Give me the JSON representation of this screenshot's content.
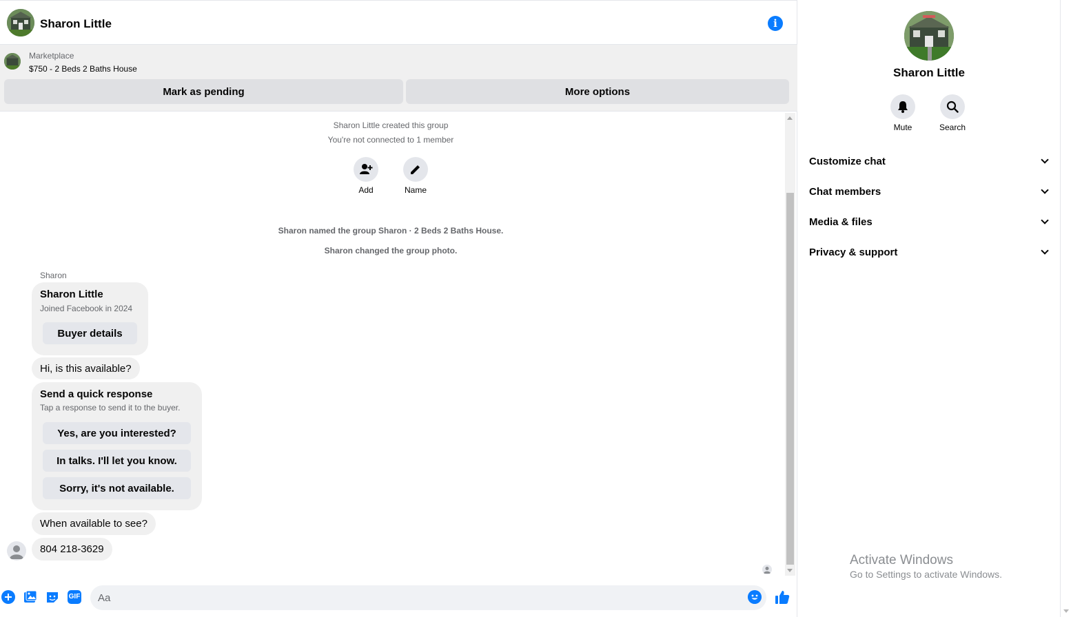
{
  "header": {
    "contact_name": "Sharon Little",
    "info_icon": "info-icon"
  },
  "marketplace": {
    "label": "Marketplace",
    "listing": "$750 - 2 Beds 2 Baths House",
    "mark_pending": "Mark as pending",
    "more_options": "More options"
  },
  "timeline": {
    "created": "Sharon Little created this group",
    "not_connected": "You're not connected to 1 member",
    "actions": [
      {
        "label": "Add",
        "icon": "add-person-icon"
      },
      {
        "label": "Name",
        "icon": "pencil-icon"
      }
    ],
    "named_group": "Sharon named the group Sharon · 2 Beds 2 Baths House.",
    "changed_photo": "Sharon changed the group photo."
  },
  "messages": {
    "sender": "Sharon",
    "profile_card": {
      "name": "Sharon Little",
      "joined": "Joined Facebook in 2024",
      "button": "Buyer details"
    },
    "msg1": "Hi, is this available?",
    "quick_response": {
      "title": "Send a quick response",
      "subtitle": "Tap a response to send it to the buyer.",
      "options": [
        "Yes, are you interested?",
        "In talks. I'll let you know.",
        "Sorry, it's not available."
      ]
    },
    "msg2": "When available to see?",
    "msg3": "804 218-3629"
  },
  "composer": {
    "placeholder": "Aa",
    "icons": [
      "plus-icon",
      "image-icon",
      "sticker-icon",
      "gif-icon",
      "emoji-icon",
      "like-icon"
    ],
    "gif_label": "GIF"
  },
  "panel": {
    "name": "Sharon Little",
    "actions": [
      {
        "label": "Mute",
        "icon": "bell-icon"
      },
      {
        "label": "Search",
        "icon": "search-icon"
      }
    ],
    "sections": [
      "Customize chat",
      "Chat members",
      "Media & files",
      "Privacy & support"
    ]
  },
  "watermark": {
    "title": "Activate Windows",
    "subtitle": "Go to Settings to activate Windows."
  },
  "colors": {
    "accent": "#0a7cff",
    "bubble": "#f0f0f0",
    "secondary_text": "#65676b"
  }
}
